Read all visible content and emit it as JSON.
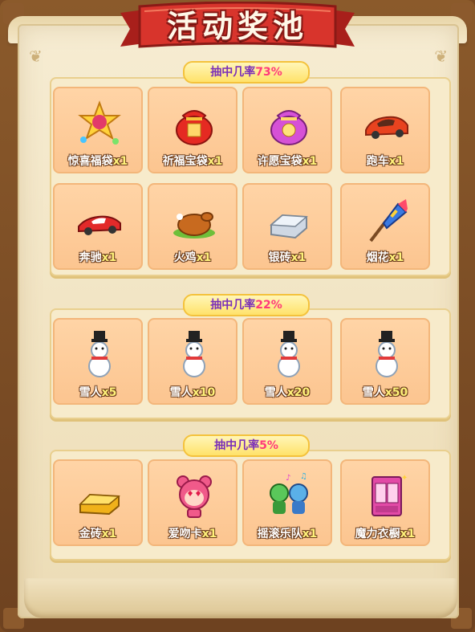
{
  "title": "活动奖池",
  "sections": [
    {
      "label": "抽中几率",
      "percent": "73%",
      "items": [
        {
          "name": "惊喜福袋",
          "qty": "x1",
          "icon": "surprise-bag-icon"
        },
        {
          "name": "祈福宝袋",
          "qty": "x1",
          "icon": "blessing-bag-icon"
        },
        {
          "name": "许愿宝袋",
          "qty": "x1",
          "icon": "wish-bag-icon"
        },
        {
          "name": "跑车",
          "qty": "x1",
          "icon": "sports-car-icon"
        },
        {
          "name": "奔驰",
          "qty": "x1",
          "icon": "benz-car-icon"
        },
        {
          "name": "火鸡",
          "qty": "x1",
          "icon": "turkey-icon"
        },
        {
          "name": "银砖",
          "qty": "x1",
          "icon": "silver-brick-icon"
        },
        {
          "name": "烟花",
          "qty": "x1",
          "icon": "firework-icon"
        }
      ]
    },
    {
      "label": "抽中几率",
      "percent": "22%",
      "items": [
        {
          "name": "雪人",
          "qty": "x5",
          "icon": "snowman-icon"
        },
        {
          "name": "雪人",
          "qty": "x10",
          "icon": "snowman-icon"
        },
        {
          "name": "雪人",
          "qty": "x20",
          "icon": "snowman-icon"
        },
        {
          "name": "雪人",
          "qty": "x50",
          "icon": "snowman-icon"
        }
      ]
    },
    {
      "label": "抽中几率",
      "percent": "5%",
      "items": [
        {
          "name": "金砖",
          "qty": "x1",
          "icon": "gold-brick-icon"
        },
        {
          "name": "爱吻卡",
          "qty": "x1",
          "icon": "love-kiss-card-icon"
        },
        {
          "name": "摇滚乐队",
          "qty": "x1",
          "icon": "rock-band-icon"
        },
        {
          "name": "魔力衣橱",
          "qty": "x1",
          "icon": "magic-wardrobe-icon"
        }
      ]
    }
  ]
}
